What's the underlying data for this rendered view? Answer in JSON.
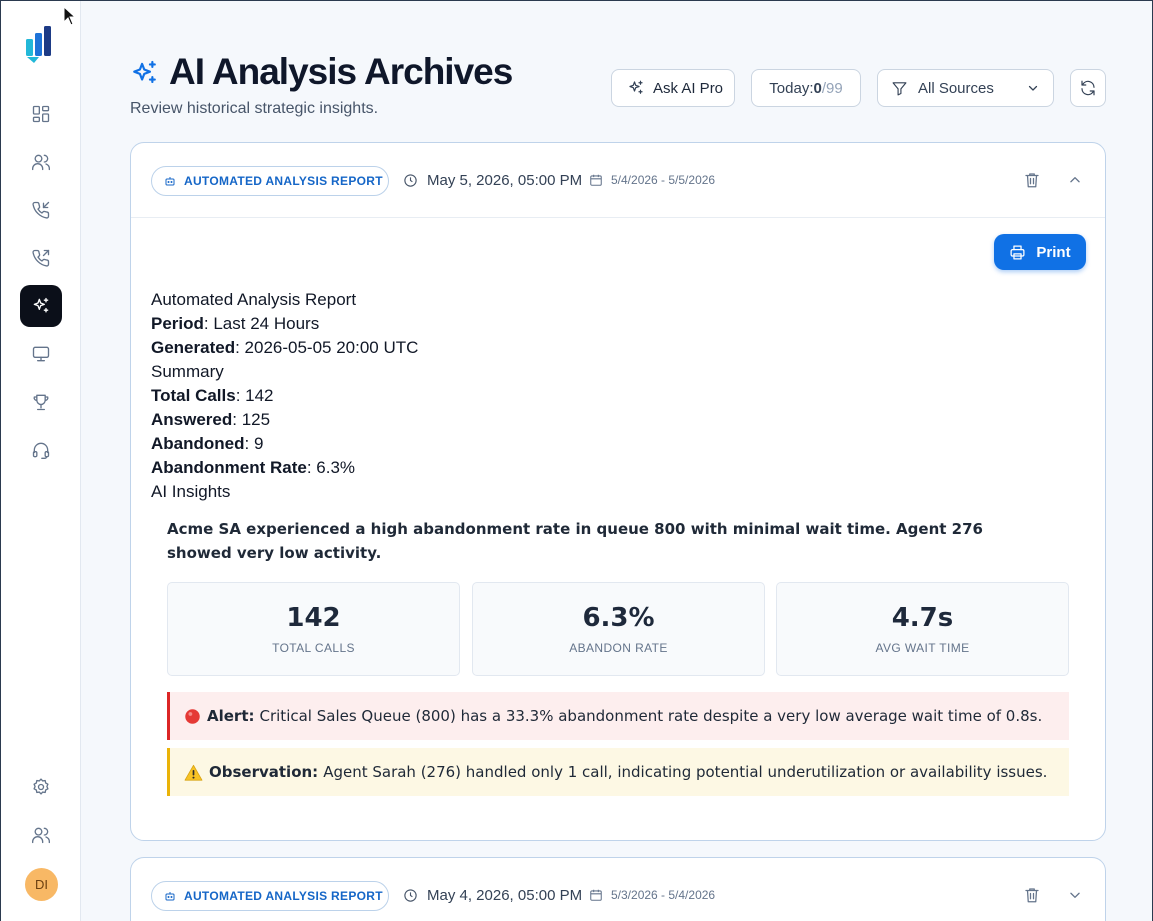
{
  "sidebar": {
    "nav_icons": [
      "dashboard-icon",
      "users-icon",
      "incoming-call-icon",
      "outgoing-call-icon",
      "ai-sparkles-icon",
      "monitor-icon",
      "trophy-icon",
      "headset-icon"
    ],
    "active": "ai-sparkles-icon",
    "bottom_icons": [
      "settings-icon",
      "team-icon"
    ],
    "avatar_initials": "DI"
  },
  "header": {
    "title": "AI Analysis Archives",
    "subtitle": "Review historical strategic insights.",
    "ask_ai_label": "Ask AI Pro",
    "today_label": "Today: ",
    "today_used": "0",
    "today_limit": "/99",
    "sources_value": "All Sources"
  },
  "reports": [
    {
      "badge": "AUTOMATED ANALYSIS REPORT",
      "datetime": "May 5, 2026, 05:00 PM",
      "range": "5/4/2026 - 5/5/2026",
      "expanded": true,
      "print_label": "Print",
      "lines": {
        "heading": "Automated Analysis Report",
        "period_label": "Period",
        "period_value": ": Last 24 Hours",
        "generated_label": "Generated",
        "generated_value": ": 2026-05-05 20:00 UTC",
        "summary_heading": "Summary",
        "total_calls_label": "Total Calls",
        "total_calls_value": ": 142",
        "answered_label": "Answered",
        "answered_value": ": 125",
        "abandoned_label": "Abandoned",
        "abandoned_value": ": 9",
        "abandon_rate_label": "Abandonment Rate",
        "abandon_rate_value": ": 6.3%",
        "insights_heading": "AI Insights"
      },
      "insight": "Acme SA experienced a high abandonment rate in queue 800 with minimal wait time. Agent 276 showed very low activity.",
      "stats": [
        {
          "value": "142",
          "label": "TOTAL CALLS"
        },
        {
          "value": "6.3%",
          "label": "ABANDON RATE"
        },
        {
          "value": "4.7s",
          "label": "AVG WAIT TIME"
        }
      ],
      "alert": {
        "icon": "red-circle-icon",
        "label": "Alert:",
        "text": "Critical Sales Queue (800) has a 33.3% abandonment rate despite a very low average wait time of 0.8s."
      },
      "observation": {
        "icon": "warning-icon",
        "label": "Observation:",
        "text": "Agent Sarah (276) handled only 1 call, indicating potential underutilization or availability issues."
      }
    },
    {
      "badge": "AUTOMATED ANALYSIS REPORT",
      "datetime": "May 4, 2026, 05:00 PM",
      "range": "5/3/2026 - 5/4/2026",
      "expanded": false
    }
  ],
  "colors": {
    "accent": "#1071e5",
    "active_nav": "#0b0f19",
    "alert_border": "#dc2626",
    "alert_bg": "#fdeeee",
    "observation_border": "#eab308",
    "observation_bg": "#fdf8e4",
    "avatar_bg": "#f8b865"
  }
}
